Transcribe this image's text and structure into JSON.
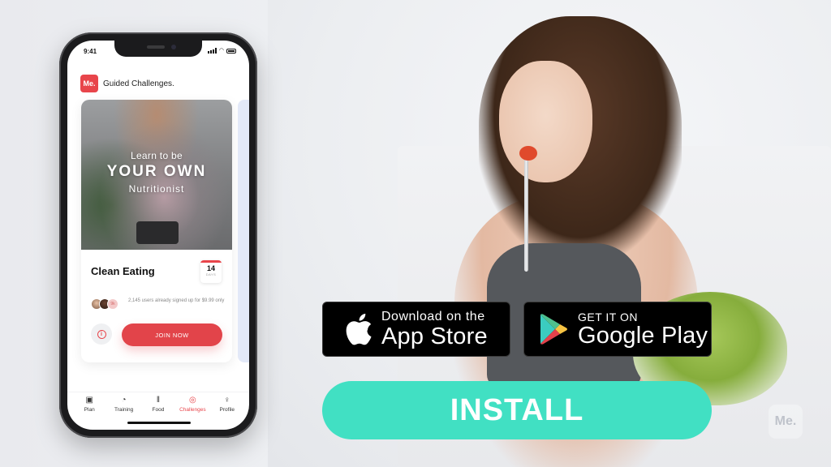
{
  "phone": {
    "status_time": "9:41",
    "app_logo": "Me.",
    "app_title": "Guided Challenges.",
    "card": {
      "image_line1": "Learn to be",
      "image_line2": "YOUR OWN",
      "image_line3": "Nutritionist",
      "title": "Clean Eating",
      "days_number": "14",
      "days_label": "DAYS",
      "avatar_more": "9k",
      "signup_text": "2,145 users already signed up for $9.99 only",
      "info_icon": "i",
      "join_label": "JOIN NOW"
    },
    "tabs": [
      {
        "label": "Plan",
        "icon": "plan-icon",
        "glyph": "▣",
        "active": false
      },
      {
        "label": "Training",
        "icon": "training-icon",
        "glyph": "◔",
        "active": false
      },
      {
        "label": "Food",
        "icon": "food-icon",
        "glyph": "ǁ",
        "active": false
      },
      {
        "label": "Challenges",
        "icon": "challenges-icon",
        "glyph": "◎",
        "active": true
      },
      {
        "label": "Profile",
        "icon": "profile-icon",
        "glyph": "♀",
        "active": false
      }
    ]
  },
  "store": {
    "apple_small": "Download on the",
    "apple_big": "App Store",
    "google_small": "GET IT ON",
    "google_big": "Google Play"
  },
  "cta": {
    "install_label": "INSTALL"
  },
  "watermark": "Me.",
  "colors": {
    "brand_red": "#e8454b",
    "install_teal": "#41e0c3"
  }
}
